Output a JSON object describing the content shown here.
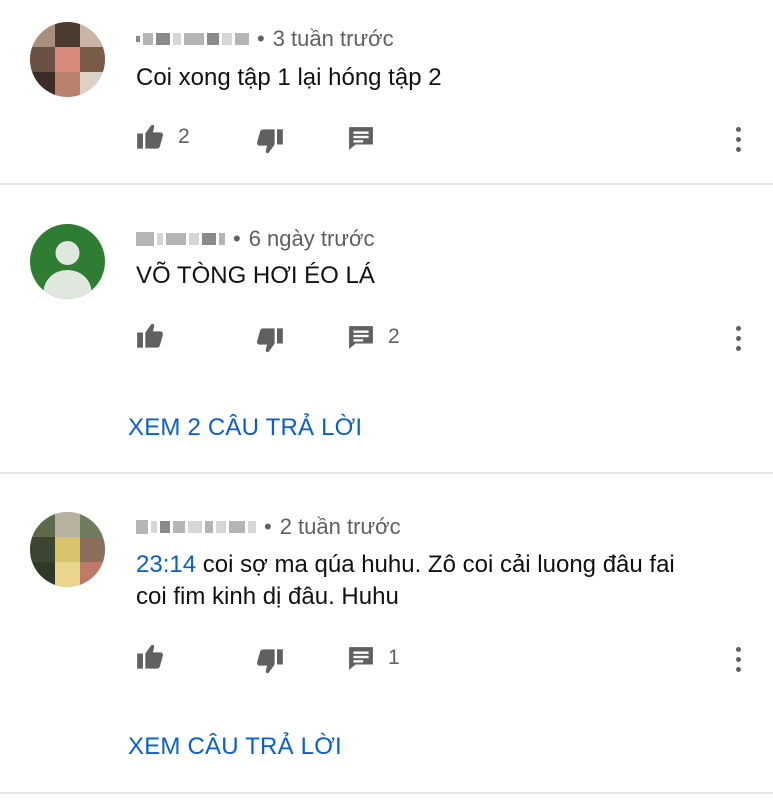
{
  "comments": [
    {
      "time": "3 tuần trước",
      "text": "Coi xong tập 1 lại hóng tập 2",
      "likes": "2",
      "replies_count": ""
    },
    {
      "time": "6 ngày trước",
      "text": "VÕ TÒNG HƠI ÉO LÁ",
      "likes": "",
      "replies_count": "2",
      "view_replies": "XEM 2 CÂU TRẢ LỜI"
    },
    {
      "time": "2 tuần trước",
      "timestamp_link": "23:14",
      "text_line1": " coi sợ ma qúa huhu. Zô coi cải luong đâu fai",
      "text_line2": "coi fim kinh dị đâu. Huhu",
      "likes": "",
      "replies_count": "1",
      "view_replies": "XEM CÂU TRẢ LỜI"
    }
  ],
  "meta_separator": "•",
  "icons": [
    "like-icon",
    "dislike-icon",
    "reply-icon",
    "more-vert-icon",
    "default-avatar-icon"
  ],
  "colors": {
    "link": "#065fd4",
    "meta": "#606060",
    "divider": "#e5e5e5",
    "default_avatar": "#2e7d32"
  }
}
